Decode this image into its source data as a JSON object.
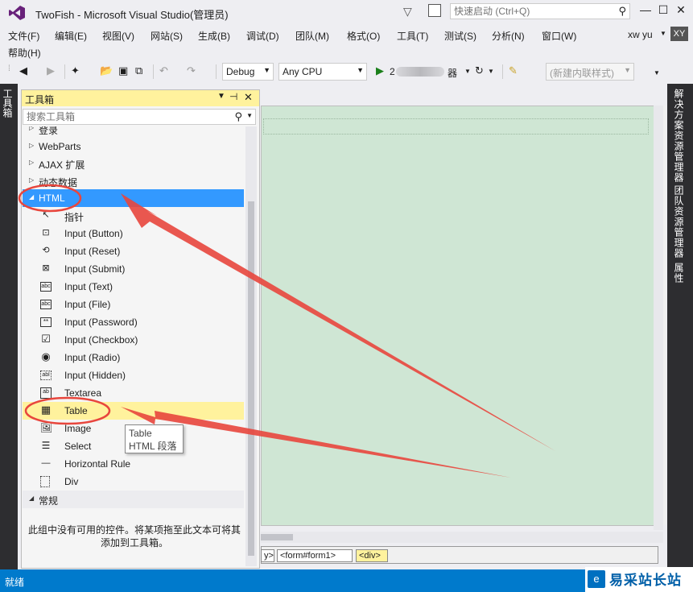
{
  "window": {
    "title": "TwoFish - Microsoft Visual Studio(管理员)",
    "quick_launch_placeholder": "快速启动 (Ctrl+Q)",
    "controls": [
      "—",
      "☐",
      "✕"
    ]
  },
  "menu": {
    "items": [
      "文件(F)",
      "编辑(E)",
      "视图(V)",
      "网站(S)",
      "生成(B)",
      "调试(D)",
      "团队(M)",
      "格式(O)",
      "工具(T)",
      "测试(S)",
      "分析(N)",
      "窗口(W)",
      "帮助(H)"
    ],
    "user_name": "xw yu",
    "user_initials": "XY"
  },
  "toolbar": {
    "config": "Debug",
    "platform": "Any CPU",
    "run_target_visible": "2",
    "run_suffix": "器",
    "style_combo": "(新建内联样式)"
  },
  "side_tabs": {
    "left": "工具箱",
    "right": [
      "解决方案资源管理器",
      "团队资源管理器",
      "属性"
    ]
  },
  "toolbox": {
    "title": "工具箱",
    "search_placeholder": "搜索工具箱",
    "groups_above": [
      "登录",
      "WebParts",
      "AJAX 扩展",
      "动态数据"
    ],
    "html_group": "HTML",
    "html_items": [
      {
        "label": "指针",
        "icon": "pointer-icon"
      },
      {
        "label": "Input (Button)",
        "icon": "input-button-icon"
      },
      {
        "label": "Input (Reset)",
        "icon": "input-reset-icon"
      },
      {
        "label": "Input (Submit)",
        "icon": "input-submit-icon"
      },
      {
        "label": "Input (Text)",
        "icon": "input-text-icon"
      },
      {
        "label": "Input (File)",
        "icon": "input-file-icon"
      },
      {
        "label": "Input (Password)",
        "icon": "input-password-icon"
      },
      {
        "label": "Input (Checkbox)",
        "icon": "checkbox-icon"
      },
      {
        "label": "Input (Radio)",
        "icon": "radio-icon"
      },
      {
        "label": "Input (Hidden)",
        "icon": "input-hidden-icon"
      },
      {
        "label": "Textarea",
        "icon": "textarea-icon"
      },
      {
        "label": "Table",
        "icon": "table-icon"
      },
      {
        "label": "Image",
        "icon": "image-icon"
      },
      {
        "label": "Select",
        "icon": "select-icon"
      },
      {
        "label": "Horizontal Rule",
        "icon": "horizontal-rule-icon"
      },
      {
        "label": "Div",
        "icon": "div-icon"
      }
    ],
    "general_group": "常规",
    "empty_message": "此组中没有可用的控件。将某项拖至此文本可将其添加到工具箱。"
  },
  "tooltip": {
    "line1": "Table",
    "line2": "HTML 段落"
  },
  "breadcrumbs": [
    "y>",
    "<form#form1>",
    "<div>"
  ],
  "status": {
    "text": "就绪"
  },
  "watermark": {
    "text": "易采站长站"
  },
  "colors": {
    "accent": "#007acc",
    "selection": "#3399ff",
    "hover": "#fff29d",
    "design_surface": "#cfe6d4",
    "annotation": "#e8463d"
  }
}
